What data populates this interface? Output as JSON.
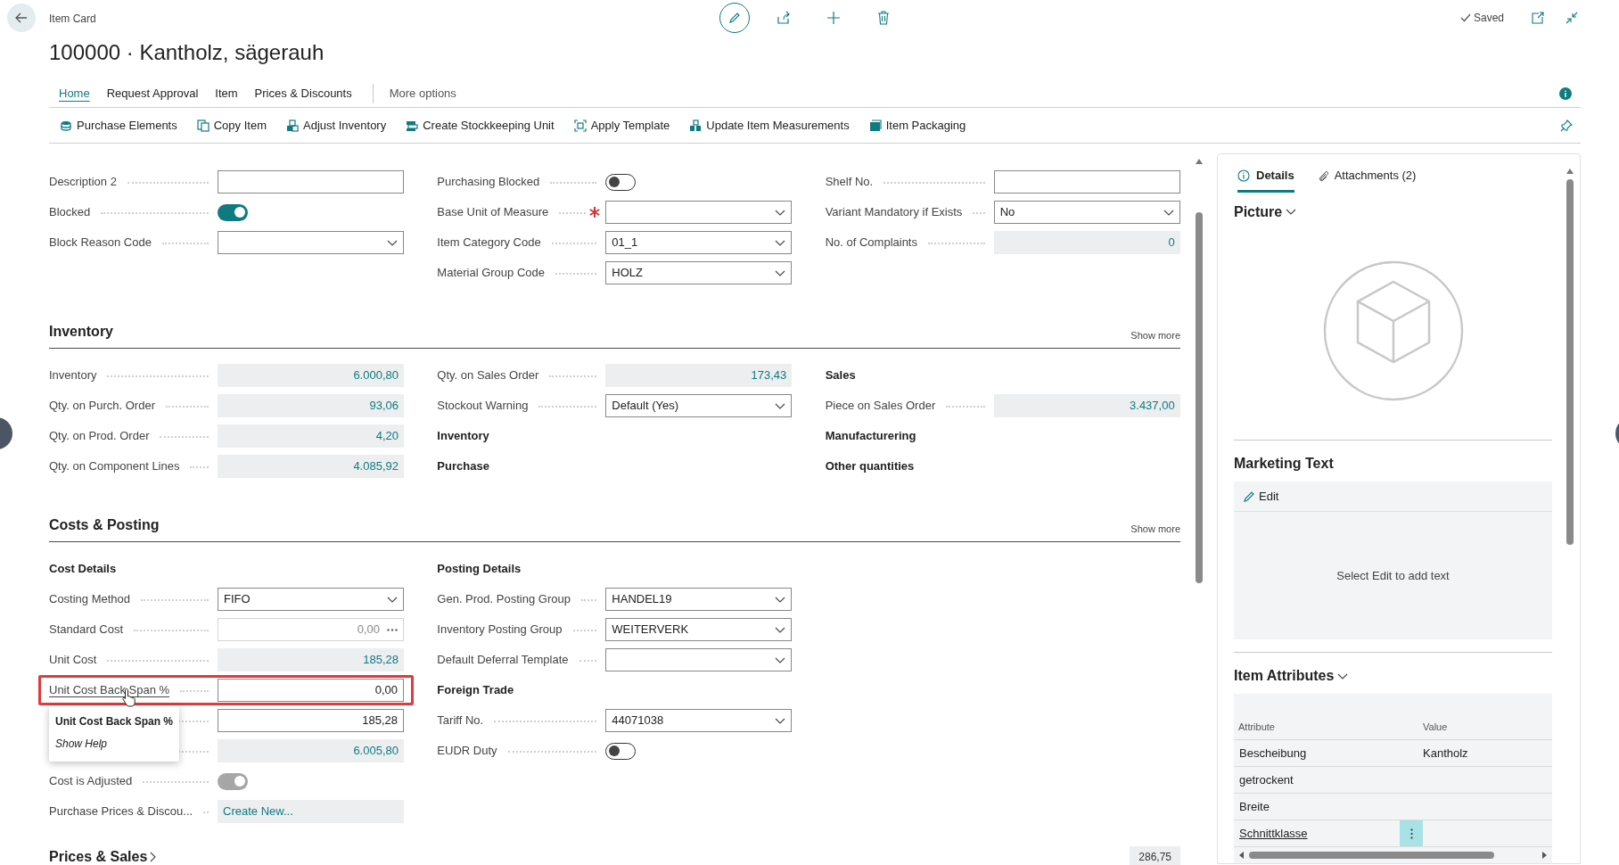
{
  "header": {
    "breadcrumb": "Item Card",
    "title": "100000 · Kantholz, sägerauh",
    "status": "Saved"
  },
  "tabs": [
    {
      "label": "Home",
      "selected": true,
      "kind": "tab"
    },
    {
      "label": "Request Approval",
      "selected": false,
      "kind": "tab"
    },
    {
      "label": "Item",
      "selected": false,
      "kind": "tab"
    },
    {
      "label": "Prices & Discounts",
      "selected": false,
      "kind": "tab"
    },
    {
      "label": "More options",
      "selected": false,
      "kind": "more"
    }
  ],
  "actions": [
    "Purchase Elements",
    "Copy Item",
    "Adjust Inventory",
    "Create Stockkeeping Unit",
    "Apply Template",
    "Update Item Measurements",
    "Item Packaging"
  ],
  "sections": [
    {
      "columns": [
        [
          {
            "label": "Description 2",
            "kind": "text"
          },
          {
            "label": "Blocked",
            "kind": "toggle",
            "on": true,
            "disabled": false
          },
          {
            "label": "Block Reason Code",
            "kind": "select"
          }
        ],
        [
          {
            "label": "Purchasing Blocked",
            "kind": "toggle",
            "on": false,
            "disabled": false,
            "required": false
          },
          {
            "label": "Base Unit of Measure",
            "kind": "select",
            "required": true
          },
          {
            "label": "Item Category Code",
            "kind": "select",
            "value": "01_1",
            "required": false
          },
          {
            "label": "Material Group Code",
            "kind": "select",
            "value": "HOLZ",
            "required": false
          }
        ],
        [
          {
            "label": "Shelf No.",
            "kind": "text"
          },
          {
            "label": "Variant Mandatory if Exists",
            "kind": "select",
            "value": "No"
          },
          {
            "label": "No. of Complaints",
            "kind": "readonly",
            "value": "0"
          }
        ]
      ]
    },
    {
      "title": "Inventory",
      "show_more": "Show more",
      "columns": [
        [
          {
            "label": "Inventory",
            "kind": "readonly",
            "value": "6.000,80"
          },
          {
            "label": "Qty. on Purch. Order",
            "kind": "readonly",
            "value": "93,06"
          },
          {
            "label": "Qty. on Prod. Order",
            "kind": "readonly",
            "value": "4,20"
          },
          {
            "label": "Qty. on Component Lines",
            "kind": "readonly",
            "value": "4.085,92"
          }
        ],
        [
          {
            "label": "Qty. on Sales Order",
            "kind": "readonly",
            "value": "173,43"
          },
          {
            "label": "Stockout Warning",
            "kind": "select",
            "value": "Default (Yes)"
          },
          {
            "label": "Inventory",
            "kind": "heading"
          },
          {
            "label": "Purchase",
            "kind": "heading"
          }
        ],
        [
          {
            "label": "Sales",
            "kind": "heading"
          },
          {
            "label": "Piece on Sales Order",
            "kind": "readonly",
            "value": "3.437,00"
          },
          {
            "label": "Manufacturering",
            "kind": "heading"
          },
          {
            "label": "Other quantities",
            "kind": "heading"
          }
        ]
      ]
    },
    {
      "title": "Costs & Posting",
      "show_more": "Show more",
      "tooltip": {
        "title": "Unit Cost Back Span %",
        "link": "Show Help"
      },
      "columns": [
        [
          {
            "label": "Cost Details",
            "kind": "heading"
          },
          {
            "label": "Costing Method",
            "kind": "select",
            "value": "FIFO",
            "highlighted": false
          },
          {
            "label": "Standard Cost",
            "kind": "assist",
            "value": "0,00",
            "highlighted": false
          },
          {
            "label": "Unit Cost",
            "kind": "readonly",
            "value": "185,28",
            "highlighted": false
          },
          {
            "label": "Unit Cost Back Span %",
            "kind": "number",
            "value": "0,00",
            "highlighted": true
          },
          {
            "kind": "number",
            "value": "185,28",
            "highlighted": false
          },
          {
            "kind": "readonly",
            "value": "6.005,80",
            "highlighted": false
          },
          {
            "label": "Cost is Adjusted",
            "kind": "toggle",
            "on": true,
            "disabled": true,
            "highlighted": false
          },
          {
            "label": "Purchase Prices & Discou...",
            "kind": "link",
            "value": "Create New...",
            "highlighted": false
          }
        ],
        [
          {
            "label": "Posting Details",
            "kind": "heading"
          },
          {
            "label": "Gen. Prod. Posting Group",
            "kind": "select",
            "value": "HANDEL19"
          },
          {
            "label": "Inventory Posting Group",
            "kind": "select",
            "value": "WEITERVERK"
          },
          {
            "label": "Default Deferral Template",
            "kind": "select"
          },
          {
            "label": "Foreign Trade",
            "kind": "heading"
          },
          {
            "label": "Tariff No.",
            "kind": "select",
            "value": "44071038"
          },
          {
            "label": "EUDR Duty",
            "kind": "toggle",
            "on": false,
            "disabled": false
          }
        ],
        []
      ]
    }
  ],
  "prices_sales": {
    "title": "Prices & Sales",
    "summary": "286,75"
  },
  "factbox": {
    "tabs": [
      {
        "label": "Details",
        "selected": true
      },
      {
        "label": "Attachments (2)",
        "selected": false
      }
    ],
    "picture": {
      "title": "Picture"
    },
    "marketing": {
      "title": "Marketing Text",
      "edit": "Edit",
      "empty_text": "Select Edit to add text"
    },
    "attributes": {
      "title": "Item Attributes",
      "columns": [
        "Attribute",
        "Value"
      ],
      "rows": [
        {
          "attribute": "Bescheibung",
          "value": "Kantholz",
          "selected": false
        },
        {
          "attribute": "getrockent",
          "selected": false
        },
        {
          "attribute": "Breite",
          "selected": false
        },
        {
          "attribute": "Schnittklasse",
          "selected": true
        }
      ]
    }
  }
}
